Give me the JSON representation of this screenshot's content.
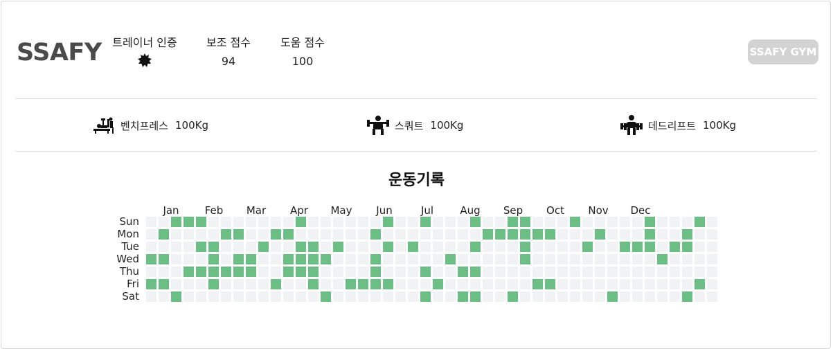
{
  "profile": {
    "name": "SSAFY",
    "gym_badge": "SSAFY GYM",
    "stats": [
      {
        "label": "트레이너 인증",
        "value": "",
        "icon": "certified-badge-icon"
      },
      {
        "label": "보조 점수",
        "value": "94"
      },
      {
        "label": "도움 점수",
        "value": "100"
      }
    ]
  },
  "lifts": [
    {
      "name": "벤치프레스",
      "weight": "100Kg",
      "icon": "bench-press-icon"
    },
    {
      "name": "스쿼트",
      "weight": "100Kg",
      "icon": "squat-icon"
    },
    {
      "name": "데드리프트",
      "weight": "100Kg",
      "icon": "deadlift-icon"
    }
  ],
  "activity": {
    "title": "운동기록",
    "months": [
      "Jan",
      "Feb",
      "Mar",
      "Apr",
      "May",
      "Jun",
      "Jul",
      "Aug",
      "Sep",
      "Oct",
      "Nov",
      "Dec"
    ],
    "days": [
      "Sun",
      "Mon",
      "Tue",
      "Wed",
      "Thu",
      "Fri",
      "Sat"
    ],
    "colors": {
      "active": "#6bbf85",
      "empty": "#f1f2f4"
    },
    "grid": [
      "0011100000001000000100100010011000100000100010000",
      "0100001100110000001000000001111110001000100100000000001",
      "0000110001001101000101000010001000010011101100100",
      "1100010110011110001000001000001000000000010000001000101",
      "0001111110011100001000100110000000000000000000010001",
      "1100010000100100111100010000000110000000000010010110",
      "0010000000000010000000100110010000000100000100110011000"
    ]
  }
}
